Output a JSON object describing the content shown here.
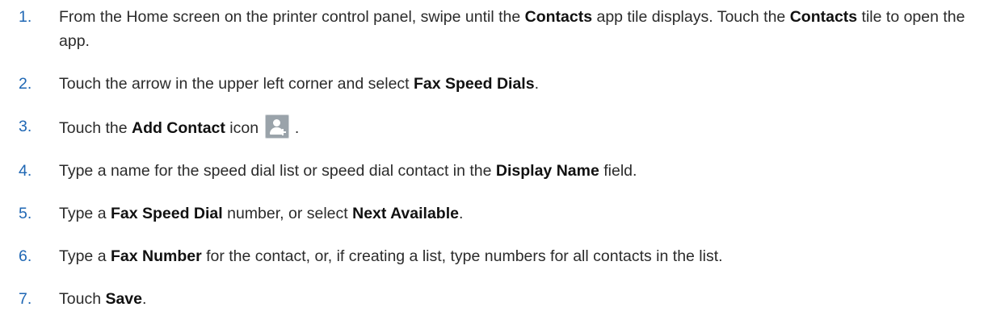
{
  "steps": [
    {
      "number": "1.",
      "parts": [
        {
          "t": "From the Home screen on the printer control panel, swipe until the "
        },
        {
          "t": "Contacts",
          "b": true
        },
        {
          "t": " app tile displays. Touch the "
        },
        {
          "t": "Contacts",
          "b": true
        },
        {
          "t": " tile to open the app."
        }
      ]
    },
    {
      "number": "2.",
      "parts": [
        {
          "t": "Touch the arrow in the upper left corner and select "
        },
        {
          "t": "Fax Speed Dials",
          "b": true
        },
        {
          "t": "."
        }
      ]
    },
    {
      "number": "3.",
      "parts": [
        {
          "t": "Touch the "
        },
        {
          "t": "Add Contact",
          "b": true
        },
        {
          "t": " icon "
        },
        {
          "icon": "add-contact-icon"
        },
        {
          "t": " ."
        }
      ]
    },
    {
      "number": "4.",
      "parts": [
        {
          "t": "Type a name for the speed dial list or speed dial contact in the "
        },
        {
          "t": "Display Name",
          "b": true
        },
        {
          "t": " field."
        }
      ]
    },
    {
      "number": "5.",
      "parts": [
        {
          "t": "Type a "
        },
        {
          "t": "Fax Speed Dial",
          "b": true
        },
        {
          "t": " number, or select "
        },
        {
          "t": "Next Available",
          "b": true
        },
        {
          "t": "."
        }
      ]
    },
    {
      "number": "6.",
      "parts": [
        {
          "t": "Type a "
        },
        {
          "t": "Fax Number",
          "b": true
        },
        {
          "t": " for the contact, or, if creating a list, type numbers for all contacts in the list."
        }
      ]
    },
    {
      "number": "7.",
      "parts": [
        {
          "t": "Touch "
        },
        {
          "t": "Save",
          "b": true
        },
        {
          "t": "."
        }
      ]
    }
  ],
  "colors": {
    "step_number": "#1f67b4",
    "body_text": "#2b2b2b",
    "icon_background": "#9aa3aa"
  }
}
